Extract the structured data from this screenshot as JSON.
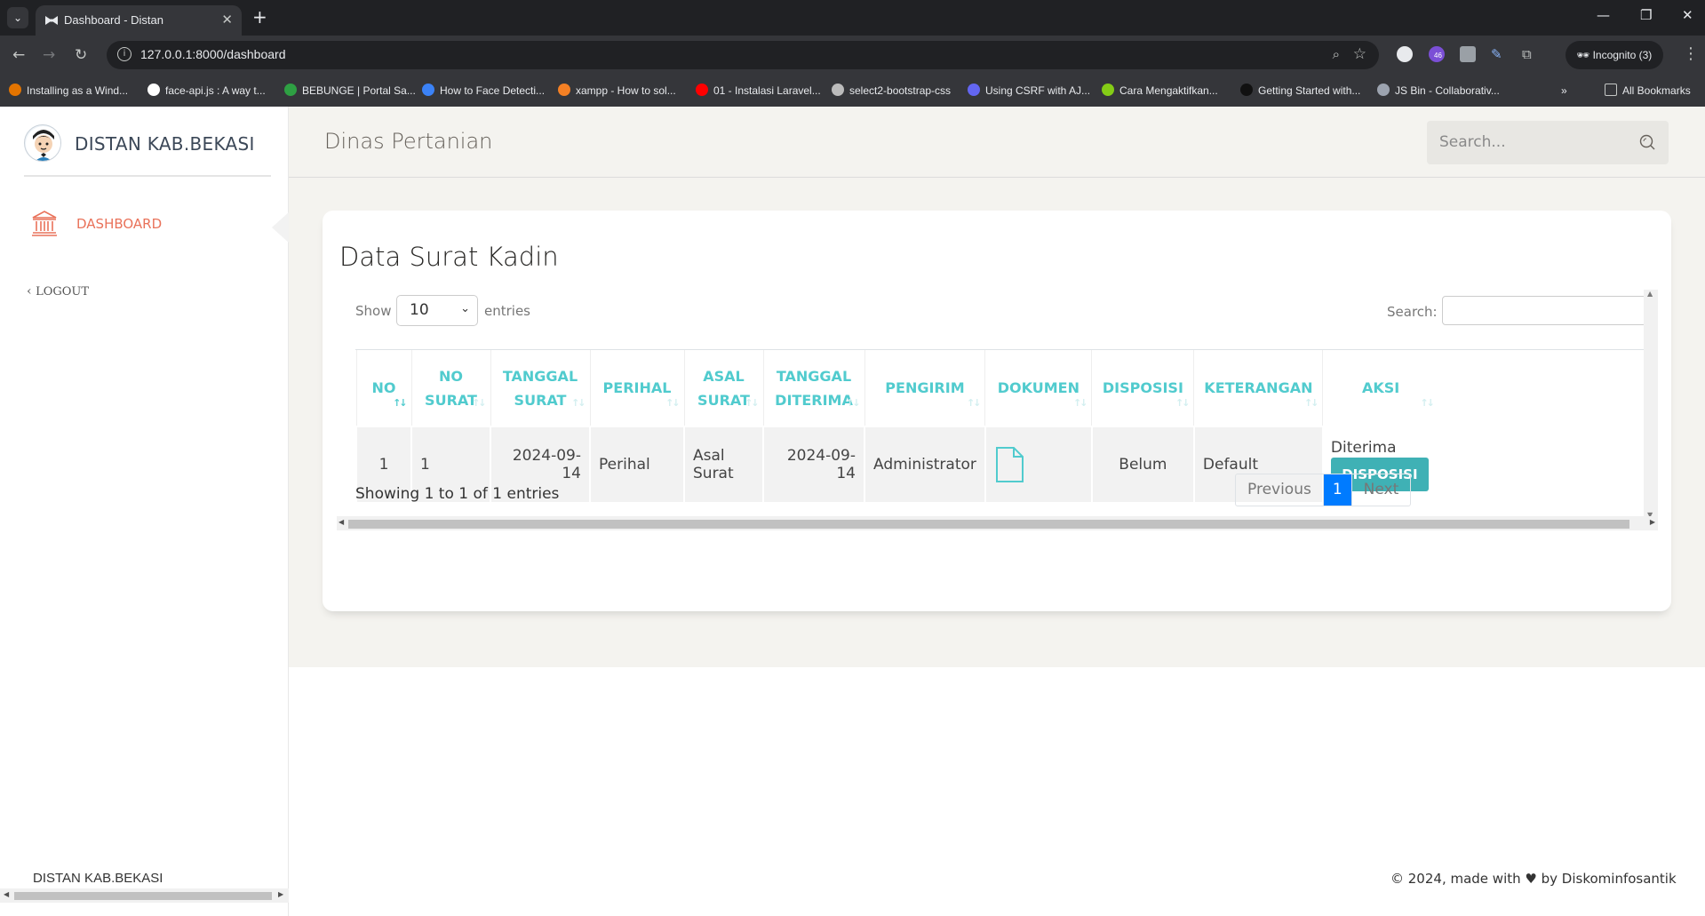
{
  "browser": {
    "tab_title": "Dashboard - Distan",
    "tab_close": "✕",
    "new_tab": "+",
    "url": "127.0.0.1:8000/dashboard",
    "incognito_label": "Incognito (3)",
    "extension_badge": "46",
    "bookmarks": [
      {
        "label": "Installing as a Wind...",
        "color": "#e37400"
      },
      {
        "label": "face-api.js : A way t...",
        "color": "#ffffff"
      },
      {
        "label": "BEBUNGE | Portal Sa...",
        "color": "#2ea043"
      },
      {
        "label": "How to Face Detecti...",
        "color": "#3b82f6"
      },
      {
        "label": "xampp - How to sol...",
        "color": "#f48024"
      },
      {
        "label": "01 - Instalasi Laravel...",
        "color": "#ff0000"
      },
      {
        "label": "select2-bootstrap-css",
        "color": "#bbbbbb"
      },
      {
        "label": "Using CSRF with AJ...",
        "color": "#6366f1"
      },
      {
        "label": "Cara Mengaktifkan...",
        "color": "#84cc16"
      },
      {
        "label": "Getting Started with...",
        "color": "#111111"
      },
      {
        "label": "JS Bin - Collaborativ...",
        "color": "#9ca3af"
      }
    ],
    "all_bookmarks": "All Bookmarks",
    "overflow": "»"
  },
  "sidebar": {
    "brand": "DISTAN KAB.BEKASI",
    "nav": [
      {
        "label": "DASHBOARD",
        "icon": "bank-icon",
        "active": true
      },
      {
        "label": "LOGOUT",
        "icon": "chevron-left-icon",
        "active": false
      }
    ],
    "footer": "DISTAN KAB.BEKASI"
  },
  "topbar": {
    "title": "Dinas Pertanian",
    "search_placeholder": "Search..."
  },
  "card": {
    "title": "Data Surat Kadin",
    "show_label": "Show",
    "entries_label": "entries",
    "page_length": "10",
    "search_label": "Search:",
    "columns": [
      [
        "NO"
      ],
      [
        "NO",
        "SURAT"
      ],
      [
        "TANGGAL",
        "SURAT"
      ],
      [
        "PERIHAL"
      ],
      [
        "ASAL",
        "SURAT"
      ],
      [
        "TANGGAL",
        "DITERIMA"
      ],
      [
        "PENGIRIM"
      ],
      [
        "DOKUMEN"
      ],
      [
        "DISPOSISI"
      ],
      [
        "KETERANGAN"
      ],
      [
        "AKSI"
      ]
    ],
    "rows": [
      {
        "no": "1",
        "no_surat": "1",
        "tanggal_surat": "2024-09-14",
        "perihal": "Perihal",
        "asal_surat": "Asal Surat",
        "tanggal_diterima": "2024-09-14",
        "pengirim": "Administrator",
        "dokumen": "file-icon",
        "disposisi": "Belum",
        "keterangan": "Default",
        "aksi_status": "Diterima",
        "aksi_button": "DISPOSISI"
      }
    ],
    "info": "Showing 1 to 1 of 1 entries",
    "pagination": {
      "previous": "Previous",
      "current": "1",
      "next": "Next"
    }
  },
  "footer": {
    "copy_prefix": "© 2024, made with",
    "copy_suffix": "by Diskominfosantik"
  },
  "colors": {
    "accent_teal": "#51cbce",
    "button_teal": "#3fb1b5",
    "active_nav": "#e9725a",
    "page_bg": "#f4f3ef",
    "pager_active": "#007bff"
  }
}
